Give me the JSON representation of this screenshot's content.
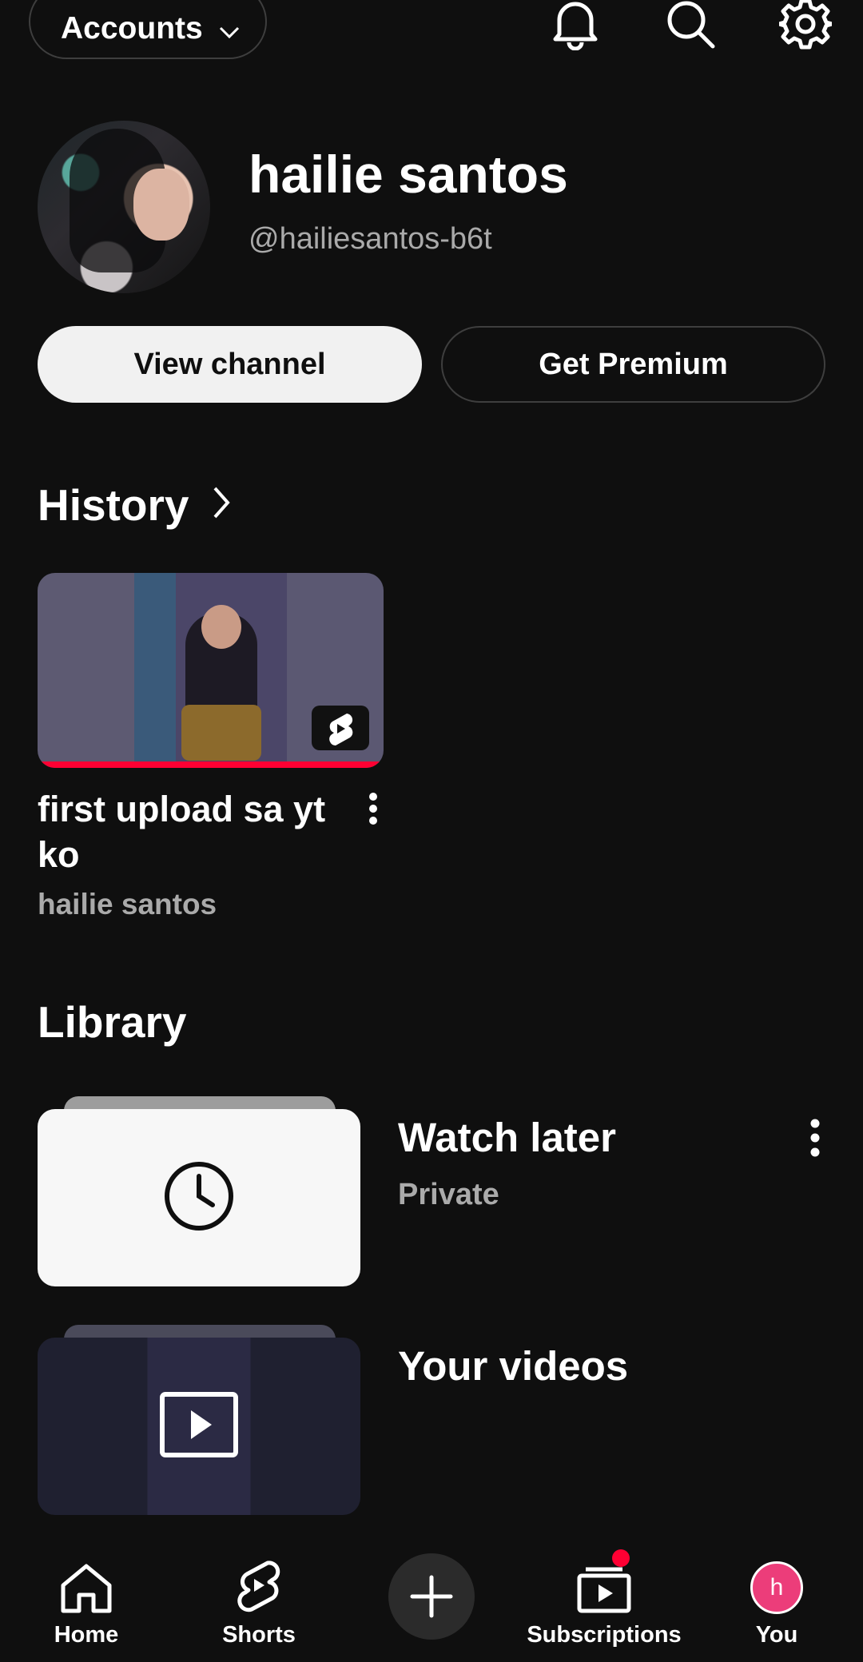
{
  "header": {
    "accounts_label": "Accounts",
    "icons": [
      "notifications-bell-icon",
      "search-icon",
      "settings-gear-icon"
    ]
  },
  "profile": {
    "name": "hailie santos",
    "handle": "@hailiesantos-b6t",
    "view_channel_label": "View channel",
    "get_premium_label": "Get Premium"
  },
  "history": {
    "title": "History",
    "items": [
      {
        "title": "first upload sa yt ko",
        "channel": "hailie santos",
        "type_icon": "shorts-icon",
        "watched_progress": 1.0,
        "progress_color": "#ff0033"
      }
    ]
  },
  "library": {
    "title": "Library",
    "items": [
      {
        "title": "Watch later",
        "subtitle": "Private",
        "icon": "clock-icon"
      },
      {
        "title": "Your videos",
        "icon": "play-icon"
      }
    ]
  },
  "bottom_nav": {
    "items": [
      {
        "label": "Home",
        "icon": "home-icon"
      },
      {
        "label": "Shorts",
        "icon": "shorts-icon"
      },
      {
        "label": "",
        "icon": "create-plus-icon"
      },
      {
        "label": "Subscriptions",
        "icon": "subscriptions-icon",
        "has_notification": true
      },
      {
        "label": "You",
        "icon": "avatar",
        "avatar_letter": "h"
      }
    ]
  },
  "colors": {
    "background": "#0f0f0f",
    "accent_red": "#ff0033",
    "avatar_pink": "#ec3d7a",
    "secondary_text": "#aaaaaa"
  }
}
